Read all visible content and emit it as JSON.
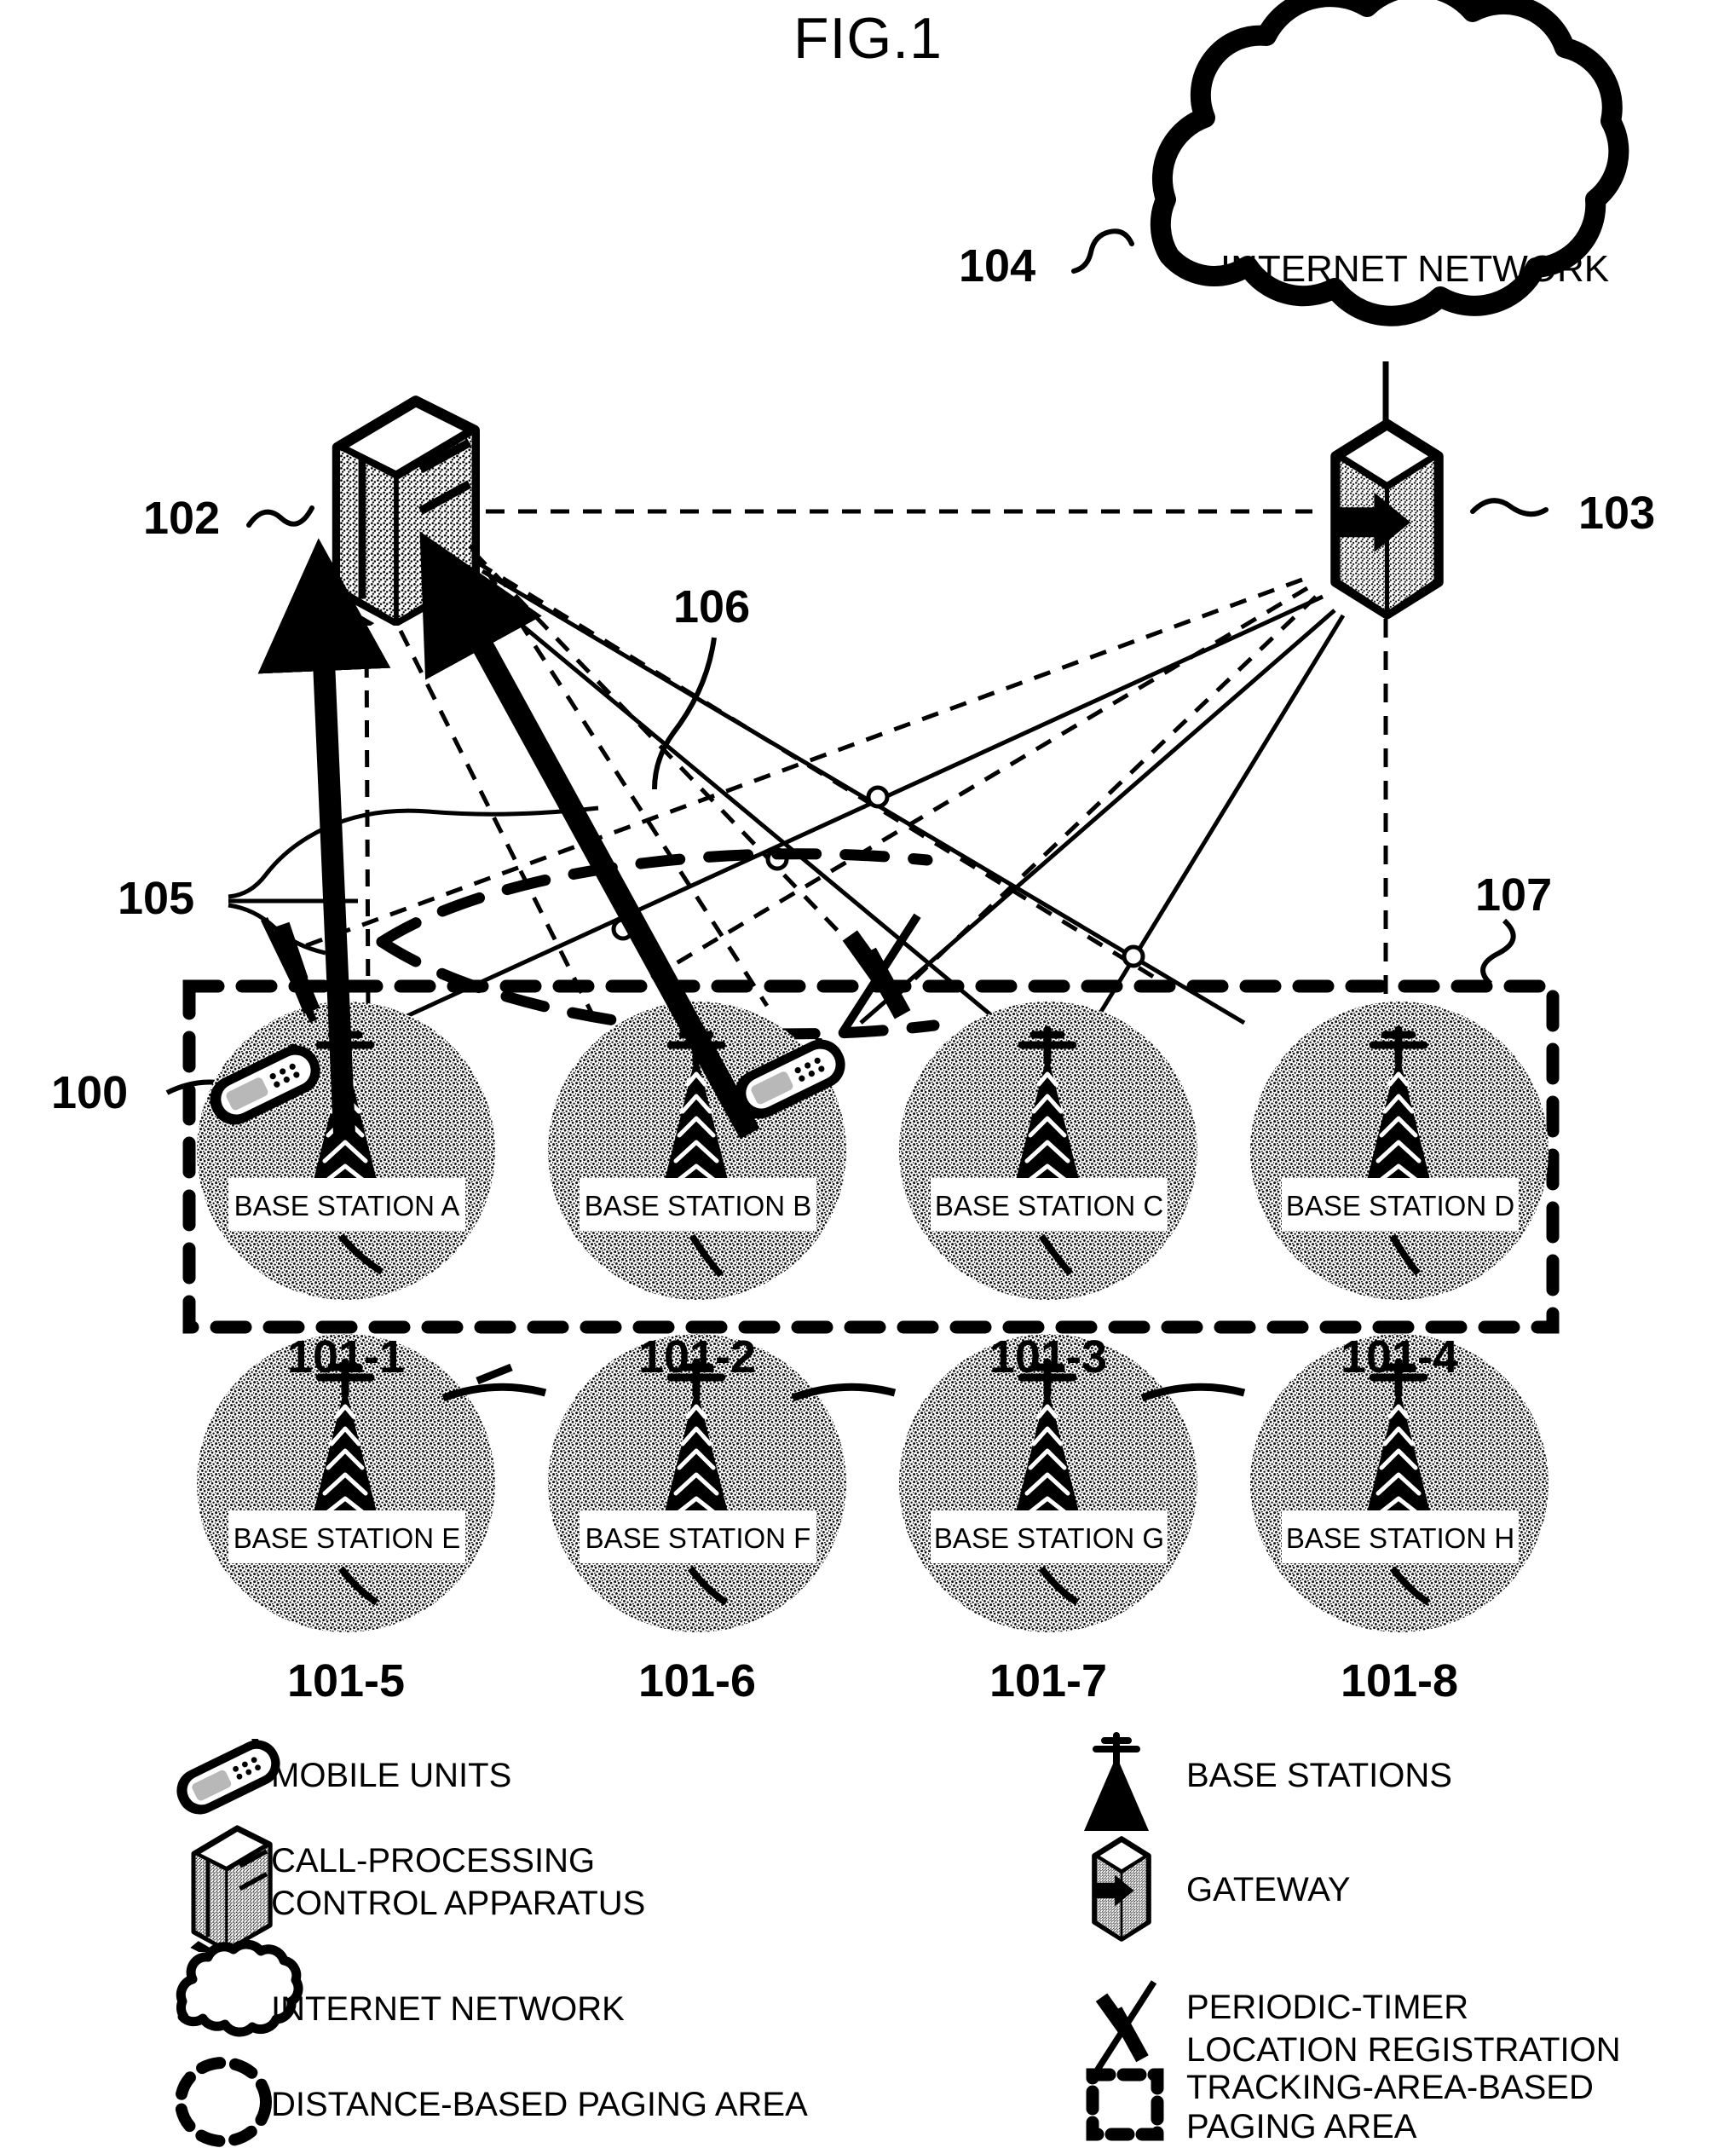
{
  "figure": {
    "title": "FIG.1"
  },
  "nodes": {
    "internet_cloud": {
      "label": "INTERNET NETWORK",
      "ref": "104"
    },
    "call_processing": {
      "ref": "102"
    },
    "gateway": {
      "ref": "103"
    },
    "mobile_units_ref": "105",
    "distance_paging_ref": "106",
    "tracking_area_ref": "107",
    "system_ref": "100"
  },
  "cells": [
    {
      "name": "BASE STATION A",
      "ref": "101-1"
    },
    {
      "name": "BASE STATION B",
      "ref": "101-2"
    },
    {
      "name": "BASE STATION C",
      "ref": "101-3"
    },
    {
      "name": "BASE STATION D",
      "ref": "101-4"
    },
    {
      "name": "BASE STATION E",
      "ref": "101-5"
    },
    {
      "name": "BASE STATION F",
      "ref": "101-6"
    },
    {
      "name": "BASE STATION G",
      "ref": "101-7"
    },
    {
      "name": "BASE STATION H",
      "ref": "101-8"
    }
  ],
  "legend": {
    "left": [
      {
        "icon": "mobile-phone-icon",
        "label": "MOBILE UNITS"
      },
      {
        "icon": "server-cabinet-icon",
        "label": "CALL-PROCESSING\nCONTROL APPARATUS",
        "line1": "CALL-PROCESSING",
        "line2": "CONTROL APPARATUS"
      },
      {
        "icon": "cloud-icon",
        "label": "INTERNET NETWORK"
      },
      {
        "icon": "dashed-ellipse-icon",
        "label": "DISTANCE-BASED PAGING AREA"
      }
    ],
    "right": [
      {
        "icon": "antenna-tower-icon",
        "label": "BASE STATIONS"
      },
      {
        "icon": "gateway-box-icon",
        "label": "GATEWAY"
      },
      {
        "icon": "zigzag-timer-icon",
        "label": "PERIODIC-TIMER\nLOCATION REGISTRATION",
        "line1": "PERIODIC-TIMER",
        "line2": "LOCATION REGISTRATION"
      },
      {
        "icon": "dashed-rect-icon",
        "label": "TRACKING-AREA-BASED\nPAGING AREA",
        "line1": "TRACKING-AREA-BASED",
        "line2": "PAGING AREA"
      }
    ]
  },
  "colors": {
    "ink": "#000000",
    "paper": "#ffffff"
  }
}
